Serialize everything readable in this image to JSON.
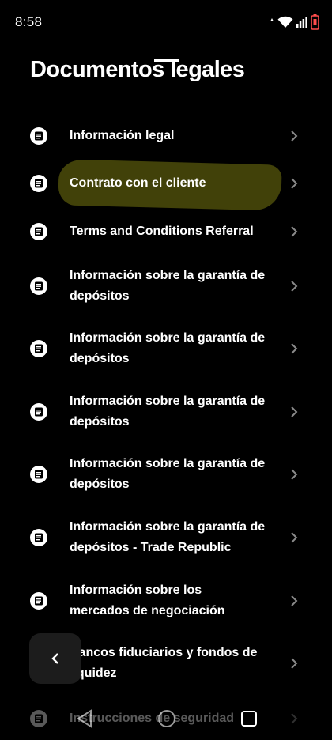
{
  "status_bar": {
    "time": "8:58"
  },
  "header": {
    "title": "Documentos legales"
  },
  "documents": [
    {
      "label": "Información legal",
      "icon": "document-icon"
    },
    {
      "label": "Contrato con el cliente",
      "icon": "document-icon",
      "highlighted": true
    },
    {
      "label": "Terms and Conditions Referral",
      "icon": "document-icon"
    },
    {
      "label": "Información sobre la garantía de depósitos",
      "icon": "document-icon"
    },
    {
      "label": "Información sobre la garantía de depósitos",
      "icon": "document-icon"
    },
    {
      "label": "Información sobre la garantía de depósitos",
      "icon": "document-icon"
    },
    {
      "label": "Información sobre la garantía de depósitos",
      "icon": "document-icon"
    },
    {
      "label": "Información sobre la garantía de depósitos - Trade Republic",
      "icon": "document-icon"
    },
    {
      "label": "Información sobre los mercados de negociación",
      "icon": "document-icon"
    },
    {
      "label": "Bancos fiduciarios y fondos de liquidez",
      "icon": "document-icon"
    },
    {
      "label": "Instrucciones de seguridad",
      "icon": "document-icon"
    }
  ],
  "colors": {
    "background": "#000000",
    "text": "#ffffff",
    "chevron": "#8a8a8a",
    "highlight": "#44440a",
    "battery": "#ff4d4d"
  }
}
